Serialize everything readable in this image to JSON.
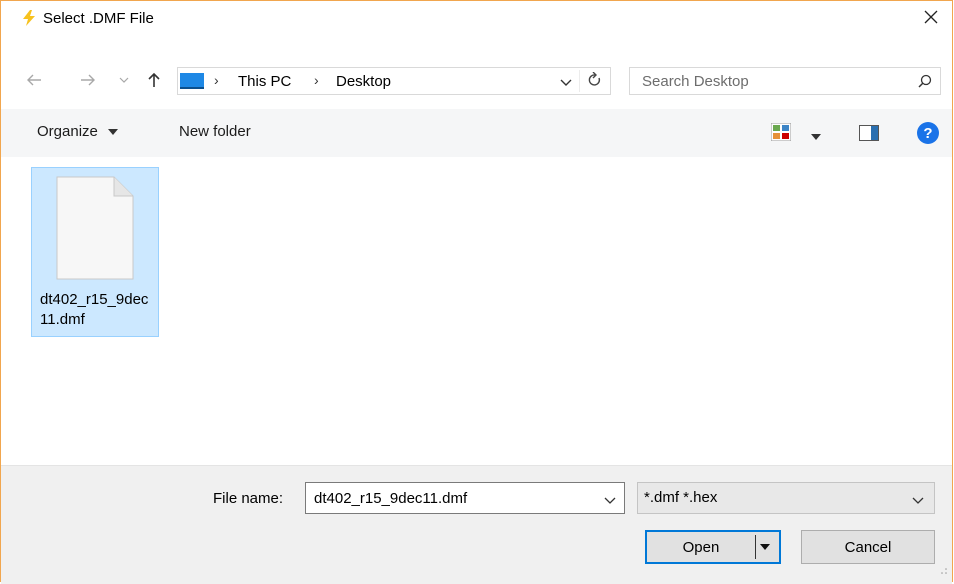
{
  "window": {
    "title": "Select .DMF File",
    "accent_color": "#f1a64e"
  },
  "navigation": {
    "breadcrumb": [
      "This PC",
      "Desktop"
    ],
    "search_placeholder": "Search Desktop"
  },
  "toolbar": {
    "organize_label": "Organize",
    "new_folder_label": "New folder",
    "help_label": "?"
  },
  "files": [
    {
      "name": "dt402_r15_9dec11.dmf",
      "selected": true
    }
  ],
  "bottom": {
    "file_name_label": "File name:",
    "file_name_value": "dt402_r15_9dec11.dmf",
    "filter_value": "*.dmf *.hex",
    "open_label": "Open",
    "cancel_label": "Cancel"
  },
  "icons": [
    "lightning-icon",
    "close-icon",
    "back-arrow-icon",
    "forward-arrow-icon",
    "chevron-down-icon",
    "up-arrow-icon",
    "pc-icon",
    "refresh-icon",
    "search-icon",
    "view-icon",
    "preview-pane-icon",
    "help-icon",
    "file-icon"
  ]
}
